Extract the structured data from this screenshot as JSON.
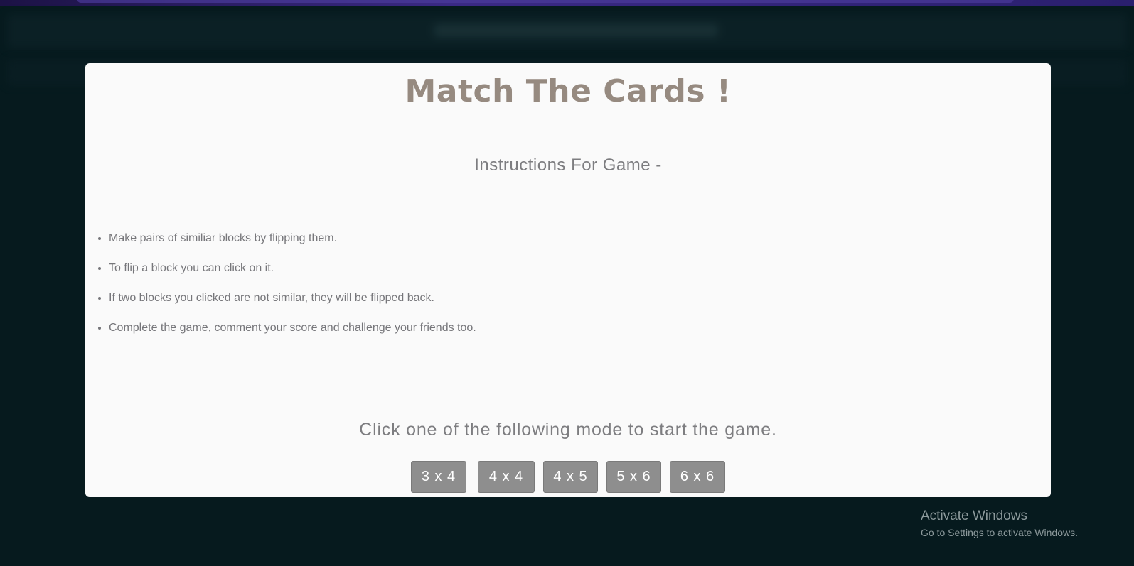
{
  "modal": {
    "title": "Match The Cards !",
    "instructions_heading": "Instructions For Game -",
    "instructions": [
      "Make pairs of similiar blocks by flipping them.",
      "To flip a block you can click on it.",
      "If two blocks you clicked are not similar, they will be flipped back.",
      "Complete the game, comment your score and challenge your friends too."
    ],
    "cta": "Click one of the following mode to start the game.",
    "modes": [
      "3 x 4",
      "4 x 4",
      "4 x 5",
      "5 x 6",
      "6 x 6"
    ]
  },
  "watermark": {
    "title": "Activate Windows",
    "subtitle": "Go to Settings to activate Windows."
  },
  "colors": {
    "background": "#061a1e",
    "modal_background": "#fafafa",
    "title_color": "#968a80",
    "button_background": "#8e8e8e",
    "button_text": "#ffffff"
  }
}
